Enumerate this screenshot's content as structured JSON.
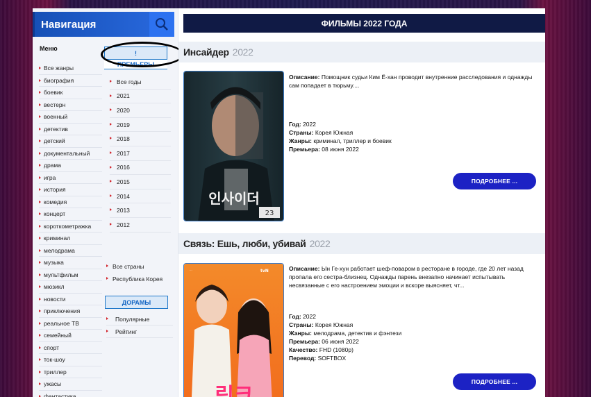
{
  "sidebar": {
    "nav_title": "Навигация",
    "menu_title": "Меню",
    "genres": [
      "Все жанры",
      "биография",
      "боевик",
      "вестерн",
      "военный",
      "детектив",
      "детский",
      "документальный",
      "драма",
      "игра",
      "история",
      "комедия",
      "концерт",
      "короткометражка",
      "криминал",
      "мелодрама",
      "музыка",
      "мультфильм",
      "мюзикл",
      "новости",
      "приключения",
      "реальное ТВ",
      "семейный",
      "спорт",
      "ток-шоу",
      "триллер",
      "ужасы",
      "фантастика"
    ],
    "exclaim_label": "!",
    "premieres_label": "ПРЕМЬЕРЫ",
    "years": [
      "Все годы",
      "2021",
      "2020",
      "2019",
      "2018",
      "2017",
      "2016",
      "2015",
      "2014",
      "2013",
      "2012"
    ],
    "countries": [
      "Все страны",
      "Республика Корея"
    ],
    "doramy_label": "ДОРАМЫ",
    "doramy_items": [
      "Популярные",
      "Рейтинг"
    ]
  },
  "main": {
    "title": "ФИЛЬМЫ 2022 ГОДА",
    "movies": [
      {
        "title": "Инсайдер",
        "year": "2022",
        "desc_label": "Описание:",
        "desc": "Помощник судьи Ким Ё-хан проводит внутренние расследования и однажды сам попадает в тюрьму....",
        "year_label": "Год:",
        "year_value": "2022",
        "country_label": "Страны:",
        "country": "Корея Южная",
        "genres_label": "Жанры:",
        "genres": "криминал, триллер и боевик",
        "premiere_label": "Премьера:",
        "premiere": "08 июня 2022",
        "button": "ПОДРОБНЕЕ ...",
        "poster_text": "인사이더"
      },
      {
        "title": "Связь: Ешь, люби, убивай",
        "year": "2022",
        "desc_label": "Описание:",
        "desc": "Ын Ге-хун работает шеф-поваром в ресторане в городе, где 20 лет назад пропала его сестра-близнец. Однажды парень внезапно начинает испытывать несвязанные с его настроением эмоции и вскоре выясняет, чт...",
        "year_label": "Год:",
        "year_value": "2022",
        "country_label": "Страны:",
        "country": "Корея Южная",
        "genres_label": "Жанры:",
        "genres": "мелодрама, детектив и фэнтези",
        "premiere_label": "Премьера:",
        "premiere": "06 июня 2022",
        "quality_label": "Качество:",
        "quality": "FHD (1080p)",
        "translation_label": "Перевод:",
        "translation": "SOFTBOX",
        "button": "ПОДРОБНЕЕ ...",
        "poster_text": "링크"
      }
    ]
  },
  "colors": {
    "nav_blue": "#1650b6",
    "title_bar": "#101a45",
    "button_blue": "#1c22c4",
    "bullet_red": "#d2232a"
  }
}
